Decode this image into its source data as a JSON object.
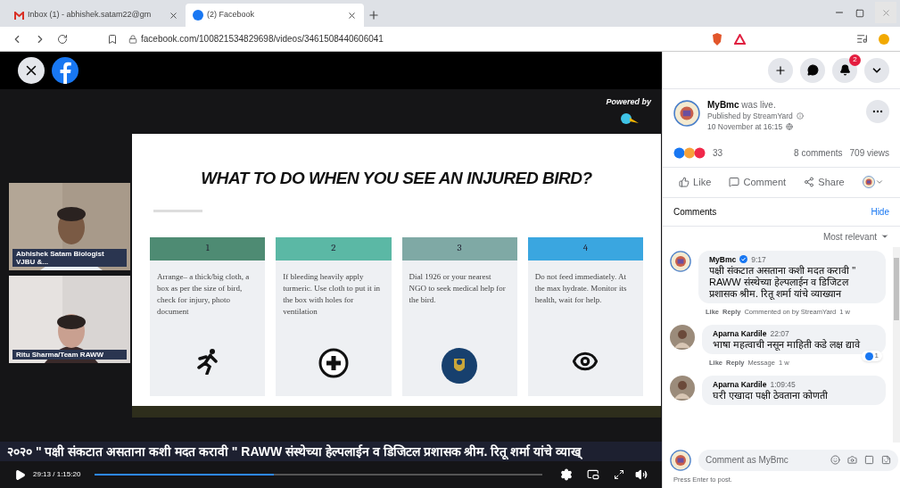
{
  "browser": {
    "tabs": [
      {
        "title": "Inbox (1) - abhishek.satam22@gm",
        "selected": false,
        "kind": "mail"
      },
      {
        "title": "(2) Facebook",
        "selected": true,
        "kind": "facebook"
      }
    ],
    "url": "facebook.com/100821534829698/videos/3461508440606041"
  },
  "video": {
    "powered_by": "Powered by",
    "participants": [
      {
        "name": "Abhishek Satam Biologist VJBU &..."
      },
      {
        "name": "Ritu Sharma/Team RAWW"
      }
    ],
    "slide": {
      "title": "WHAT TO DO WHEN YOU SEE AN INJURED BIRD?",
      "steps": [
        {
          "number": "1",
          "text": "Arrange– a thick/big cloth, a box as per the size of bird, check for injury, photo document",
          "color": "#4e8b73",
          "kind": "run"
        },
        {
          "number": "2",
          "text": "If bleeding heavily apply turmeric. Use cloth to put it in the box with holes for ventilation",
          "color": "#5bb8a5",
          "kind": "plus"
        },
        {
          "number": "3",
          "text": "Dial 1926 or your nearest NGO to seek medical help for the bird.",
          "color": "#7fa9a5",
          "kind": "emblem"
        },
        {
          "number": "4",
          "text": "Do not feed immediately. At the max hydrate. Monitor its health, wait for help.",
          "color": "#3aa6e0",
          "kind": "eye"
        }
      ]
    },
    "ticker": "२०२० \" पक्षी संकटात असताना कशी मदत करावी \" RAWW संस्थेच्या हेल्पलाईन व डिजिटल प्रशासक श्रीम. रितू शर्मा यांचे व्याख्",
    "time": "29:13 / 1:15:20",
    "progress": {
      "level": 0.4
    }
  },
  "header": {
    "notifications": "2"
  },
  "post": {
    "author": "MyBmc",
    "action": "was live.",
    "published": "Published by StreamYard",
    "date": "10 November at 16:15",
    "reactions": "33",
    "comments_count": "8 comments",
    "views": "709 views",
    "actions": [
      "Like",
      "Comment",
      "Share"
    ],
    "comments_title": "Comments",
    "hide": "Hide",
    "sort": "Most relevant",
    "comments": [
      {
        "author": "MyBmc",
        "verified": true,
        "time": "9:17",
        "text": "पक्षी संकटात असताना कशी मदत करावी \" RAWW संस्थेच्या हेल्पलाईन व डिजिटल प्रशासक श्रीम. रितू शर्मा यांचे व्याख्यान",
        "links": [
          "Like",
          "Reply"
        ],
        "info": "Commented on by StreamYard",
        "age": "1 w"
      },
      {
        "author": "Aparna Kardile",
        "verified": false,
        "time": "22:07",
        "text": "भाषा महत्वाची नसून माहिती कडे लक्ष द्यावे",
        "links": [
          "Like",
          "Reply"
        ],
        "info": "Message",
        "age": "1 w",
        "likes": "1"
      },
      {
        "author": "Aparna Kardile",
        "verified": false,
        "time": "1:09:45",
        "text": "घरी एखादा पक्षी ठेवताना कोणती"
      }
    ],
    "composer": {
      "placeholder": "Comment as MyBmc",
      "hint": "Press Enter to post."
    }
  }
}
